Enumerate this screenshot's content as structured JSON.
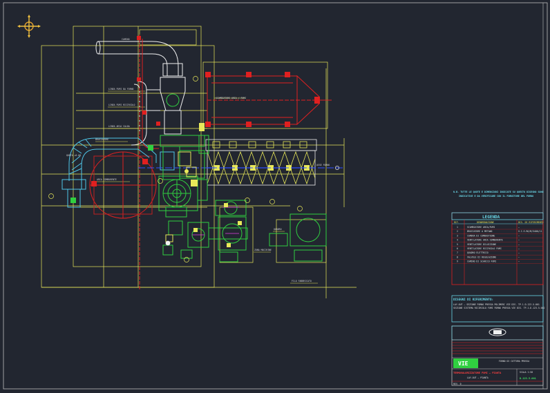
{
  "colors": {
    "background": "#222630",
    "frame": "#c8c8c8",
    "structure": "#e8e85a",
    "duct": "#f0f0f0",
    "ductwork": "#4fc6e8",
    "refractory": "#e02020",
    "equipment": "#30d040",
    "axis": "#3050ff",
    "magenta": "#e040e0"
  },
  "legend": {
    "title": "LEGENDA",
    "header_ref": "RIF.",
    "header_desc": "DENOMINAZIONE",
    "header_doc": "DIS. DI RIFERIMENTO",
    "rows": [
      {
        "ref": "1",
        "desc": "SCAMBIATORE ARIA/FUMI",
        "doc": "—"
      },
      {
        "ref": "2",
        "desc": "BRUCIATORE A METANO",
        "doc": "V.I.E.RO/M/3400/11"
      },
      {
        "ref": "3",
        "desc": "CAMERA DI COMBUSTIONE",
        "doc": "—"
      },
      {
        "ref": "4",
        "desc": "VENTILATORE ARIA COMBURENTE",
        "doc": "—"
      },
      {
        "ref": "5",
        "desc": "VENTILATORE DILUIZIONE",
        "doc": "—"
      },
      {
        "ref": "6",
        "desc": "VENTILATORE RICIRCOLO FUMI",
        "doc": "—"
      },
      {
        "ref": "7",
        "desc": "QUADRO ELETTRICO",
        "doc": "—"
      },
      {
        "ref": "8",
        "desc": "VALVOLE DI REGOLAZIONE",
        "doc": "—"
      },
      {
        "ref": "9",
        "desc": "CAMINO DI SCARICO FUMI",
        "doc": "—"
      }
    ]
  },
  "reference_drawings": {
    "title": "DISEGNI DI RIFERIMENTO:",
    "lines": [
      "LAY-OUT – SEZIONE FORNO PRESSA POLIMERI    VIE DIS. TP.1.D.123.5.001",
      "SEZIONE SISTEMA RICIRCOLO FUMI FORNO PRESSA    VIE DIS. TP.1.D.123.5.002"
    ]
  },
  "top_note": {
    "line1": "N.B. TUTTE LE QUOTE E DIMENSIONI INDICATE SU QUESTO DISEGNO SONO",
    "line2": "INDICATIVE E DA VERIFICARE CON IL FORNITORE DEL FORNO"
  },
  "title_block": {
    "logo": "VIE",
    "client_line": "FORNO DI COTTURA PRESSA",
    "drawing_title": "TERMOVALORIZZATORE FUMI – PIANTA",
    "subtitle": "LAY-OUT – PIANTA",
    "drawing_number": "D.123.5.001",
    "scale_label": "SCALA 1:50",
    "rev_label": "REV. 0"
  },
  "labels": {
    "stack": "CAMINO",
    "heat_exchanger": "SCAMBIATORE ARIA / FUMI",
    "combustion_air": "ARIA COMBURENTE",
    "duct_a": "LINEA FUMI DA FORNO",
    "duct_b": "LINEA FUMI RICIRCOLO",
    "duct_c": "LINEA ARIA CALDA",
    "burner": "BRUCIATORE",
    "control_panel": "QUADRO",
    "building_line": "FILO FABBRICATO",
    "axis_ref": "ASSE FORNO",
    "equipment_zone": "ZONA MACCHINE",
    "elevation": "QUOTA +0.00"
  }
}
